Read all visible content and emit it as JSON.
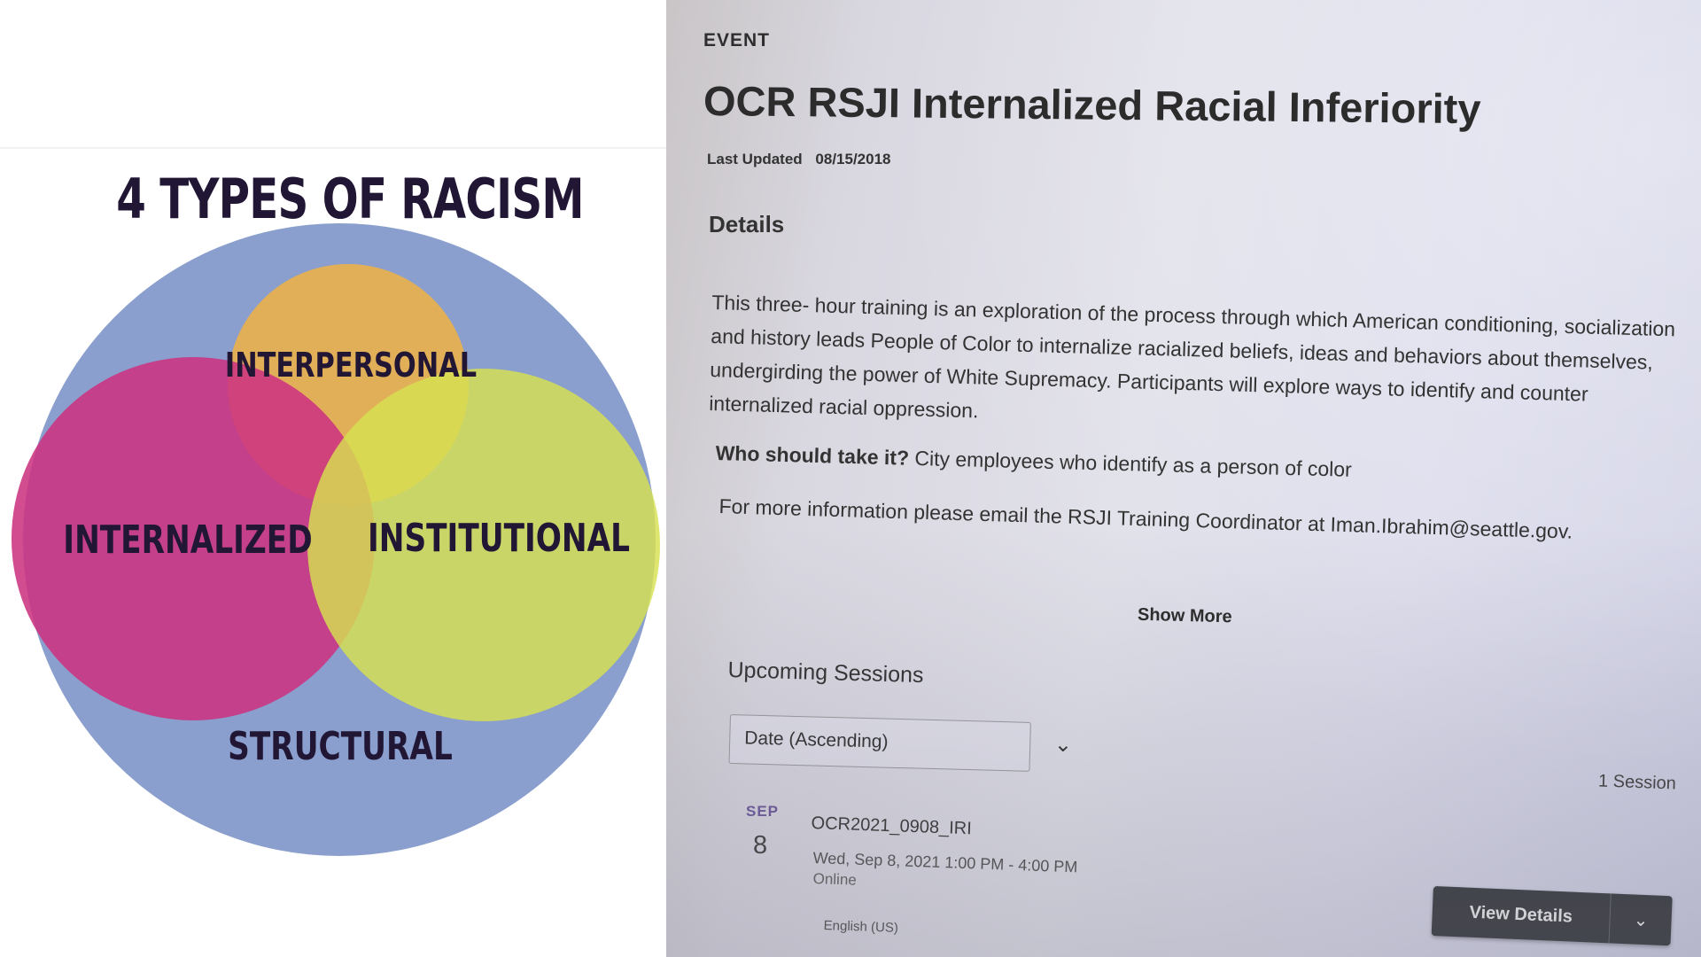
{
  "diagram": {
    "title": "4 TYPES OF RACISM",
    "labels": {
      "interpersonal": "INTERPERSONAL",
      "internalized": "INTERNALIZED",
      "institutional": "INSTITUTIONAL",
      "structural": "STRUCTURAL"
    },
    "colors": {
      "structural": "#8a9fcd",
      "interpersonal": "#ebb04d",
      "internalized": "#cc3381",
      "institutional": "#d7e051"
    }
  },
  "event": {
    "label": "EVENT",
    "title": "OCR RSJI Internalized Racial Inferiority",
    "last_updated_label": "Last Updated",
    "last_updated_value": "08/15/2018",
    "details_heading": "Details",
    "details_text": "This three- hour training is an exploration of the process through which American conditioning, socialization and history leads People of Color to internalize racialized beliefs, ideas and behaviors about themselves, undergirding the power of White Supremacy. Participants will explore ways to identify and counter internalized racial oppression.",
    "who_label": "Who should take it?",
    "who_value": "City employees who identify as a person of color",
    "info_text": "For more information please email the  RSJI Training Coordinator at Iman.Ibrahim@seattle.gov.",
    "show_more": "Show More",
    "upcoming_heading": "Upcoming Sessions",
    "sort_selected": "Date (Ascending)",
    "session_count": "1 Session",
    "session": {
      "month": "SEP",
      "day": "8",
      "code": "OCR2021_0908_IRI",
      "time": "Wed, Sep 8, 2021 1:00 PM - 4:00 PM",
      "mode": "Online",
      "language": "English (US)",
      "view_details": "View Details"
    }
  }
}
